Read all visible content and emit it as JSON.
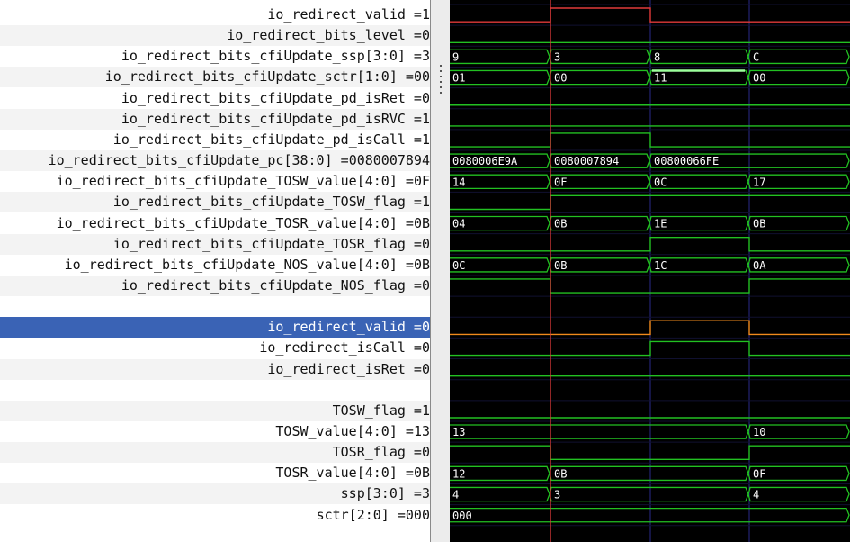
{
  "signals": [
    {
      "name": "io_redirect_valid",
      "value": "1",
      "id": "s0"
    },
    {
      "name": "io_redirect_bits_level",
      "value": "0",
      "id": "s1"
    },
    {
      "name": "io_redirect_bits_cfiUpdate_ssp[3:0]",
      "value": "3",
      "id": "s2"
    },
    {
      "name": "io_redirect_bits_cfiUpdate_sctr[1:0]",
      "value": "00",
      "id": "s3"
    },
    {
      "name": "io_redirect_bits_cfiUpdate_pd_isRet",
      "value": "0",
      "id": "s4"
    },
    {
      "name": "io_redirect_bits_cfiUpdate_pd_isRVC",
      "value": "1",
      "id": "s5"
    },
    {
      "name": "io_redirect_bits_cfiUpdate_pd_isCall",
      "value": "1",
      "id": "s6"
    },
    {
      "name": "io_redirect_bits_cfiUpdate_pc[38:0]",
      "value": "0080007894",
      "id": "s7"
    },
    {
      "name": "io_redirect_bits_cfiUpdate_TOSW_value[4:0]",
      "value": "0F",
      "id": "s8"
    },
    {
      "name": "io_redirect_bits_cfiUpdate_TOSW_flag",
      "value": "1",
      "id": "s9"
    },
    {
      "name": "io_redirect_bits_cfiUpdate_TOSR_value[4:0]",
      "value": "0B",
      "id": "s10"
    },
    {
      "name": "io_redirect_bits_cfiUpdate_TOSR_flag",
      "value": "0",
      "id": "s11"
    },
    {
      "name": "io_redirect_bits_cfiUpdate_NOS_value[4:0]",
      "value": "0B",
      "id": "s12"
    },
    {
      "name": "io_redirect_bits_cfiUpdate_NOS_flag",
      "value": "0",
      "id": "s13"
    },
    {
      "name": "",
      "value": "",
      "id": "blank1"
    },
    {
      "name": "io_redirect_valid",
      "value": "0",
      "id": "s15",
      "selected": true
    },
    {
      "name": "io_redirect_isCall",
      "value": "0",
      "id": "s16"
    },
    {
      "name": "io_redirect_isRet",
      "value": "0",
      "id": "s17"
    },
    {
      "name": "",
      "value": "",
      "id": "blank2"
    },
    {
      "name": "TOSW_flag",
      "value": "1",
      "id": "s19"
    },
    {
      "name": "TOSW_value[4:0]",
      "value": "13",
      "id": "s20"
    },
    {
      "name": "TOSR_flag",
      "value": "0",
      "id": "s21"
    },
    {
      "name": "TOSR_value[4:0]",
      "value": "0B",
      "id": "s22"
    },
    {
      "name": "ssp[3:0]",
      "value": "3",
      "id": "s23"
    },
    {
      "name": "sctr[2:0]",
      "value": "000",
      "id": "s24"
    }
  ],
  "cursor_color": "#e03a3a",
  "wave_color": "#22c022",
  "waves": [
    {
      "kind": "bit",
      "levels": [
        0,
        1,
        0,
        0
      ],
      "color": "#e03a3a"
    },
    {
      "kind": "bit",
      "levels": [
        0,
        0,
        0,
        0
      ]
    },
    {
      "kind": "bus",
      "values": [
        "9",
        "3",
        "8",
        "C"
      ]
    },
    {
      "kind": "bus",
      "values": [
        "01",
        "00",
        "11",
        "00"
      ],
      "highlight_segment": 2
    },
    {
      "kind": "bit",
      "levels": [
        0,
        0,
        0,
        0
      ]
    },
    {
      "kind": "bit",
      "levels": [
        0,
        0,
        0,
        0
      ]
    },
    {
      "kind": "bit",
      "levels": [
        0,
        1,
        0,
        0
      ]
    },
    {
      "kind": "bus",
      "values": [
        "0080006E9A",
        "0080007894",
        "00800066FE",
        "00800066FE"
      ]
    },
    {
      "kind": "bus",
      "values": [
        "14",
        "0F",
        "0C",
        "17"
      ]
    },
    {
      "kind": "bit",
      "levels": [
        0,
        1,
        1,
        1
      ]
    },
    {
      "kind": "bus",
      "values": [
        "04",
        "0B",
        "1E",
        "0B"
      ]
    },
    {
      "kind": "bit",
      "levels": [
        0,
        0,
        1,
        0
      ]
    },
    {
      "kind": "bus",
      "values": [
        "0C",
        "0B",
        "1C",
        "0A"
      ]
    },
    {
      "kind": "bit",
      "levels": [
        1,
        0,
        0,
        1
      ]
    },
    {
      "kind": "none"
    },
    {
      "kind": "bit",
      "levels": [
        0,
        0,
        1,
        0
      ],
      "color": "#f08a1c"
    },
    {
      "kind": "bit",
      "levels": [
        0,
        0,
        1,
        0
      ]
    },
    {
      "kind": "bit",
      "levels": [
        0,
        0,
        0,
        0
      ]
    },
    {
      "kind": "none"
    },
    {
      "kind": "bit",
      "levels": [
        0,
        0,
        0,
        0
      ]
    },
    {
      "kind": "bus",
      "values": [
        "13",
        "13",
        "13",
        "10"
      ]
    },
    {
      "kind": "bit",
      "levels": [
        1,
        0,
        0,
        1
      ]
    },
    {
      "kind": "bus",
      "values": [
        "12",
        "0B",
        "0B",
        "0F"
      ]
    },
    {
      "kind": "bus",
      "values": [
        "4",
        "3",
        "3",
        "4"
      ]
    },
    {
      "kind": "bus",
      "values": [
        "000",
        "000",
        "000",
        "000"
      ]
    }
  ]
}
